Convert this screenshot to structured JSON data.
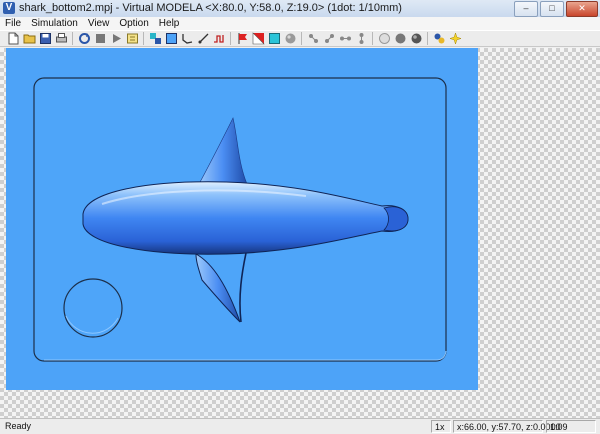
{
  "window": {
    "title": "shark_bottom2.mpj - Virtual MODELA <X:80.0, Y:58.0, Z:19.0> (1dot: 1/10mm)",
    "app_icon_letter": "V",
    "controls": {
      "minimize": "–",
      "maximize": "□",
      "close": "✕"
    }
  },
  "menu": {
    "items": [
      {
        "label": "File"
      },
      {
        "label": "Simulation"
      },
      {
        "label": "View"
      },
      {
        "label": "Option"
      },
      {
        "label": "Help"
      }
    ]
  },
  "toolbar": {
    "groups": [
      [
        "new-file-icon",
        "open-folder-icon",
        "save-icon",
        "print-icon"
      ],
      [
        "restart-icon",
        "stop-icon",
        "play-icon",
        "step-icon"
      ],
      [
        "mill-view-icon",
        "material-icon",
        "flat-mill-icon",
        "ball-mill-icon",
        "cutting-path-icon"
      ],
      [
        "red-flag-icon",
        "red-white-icon",
        "cyan-square-icon",
        "gray-sphere-icon"
      ],
      [
        "rotate-view-1-icon",
        "rotate-view-2-icon",
        "rotate-view-3-icon",
        "rotate-view-4-icon"
      ],
      [
        "shade-light-icon",
        "shade-dark-icon",
        "shade-full-icon"
      ],
      [
        "color-wheel-icon",
        "sparkle-icon"
      ]
    ]
  },
  "colors": {
    "material": "#4da3f8",
    "model": "#3d7ff2",
    "model_highlight": "#9fcbfb",
    "pocket_edge": "#1c2f4a"
  },
  "status": {
    "message": "Ready",
    "zoom": "1x",
    "coords": "x:66.00, y:57.70, z:0.0000",
    "time": "1:09"
  }
}
